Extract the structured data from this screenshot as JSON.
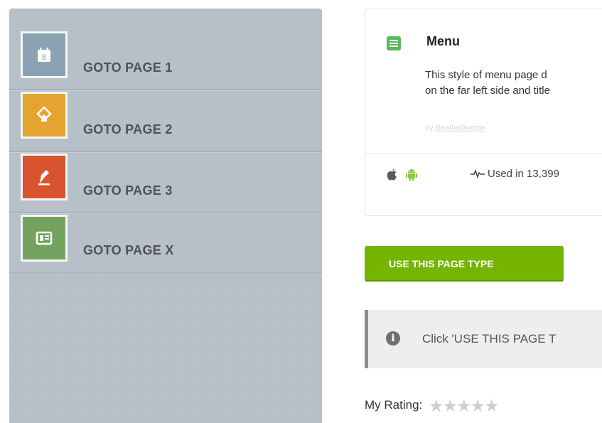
{
  "preview": {
    "menu_items": [
      {
        "label": "GOTO PAGE 1",
        "icon": "calendar-icon",
        "color": "#8aa2b4"
      },
      {
        "label": "GOTO PAGE 2",
        "icon": "thumbs-up-tag-icon",
        "color": "#e5a431"
      },
      {
        "label": "GOTO PAGE 3",
        "icon": "pen-icon",
        "color": "#d8542e"
      },
      {
        "label": "GOTO PAGE X",
        "icon": "contact-card-icon",
        "color": "#74a360"
      }
    ],
    "calendar_number": "8"
  },
  "card": {
    "title": "Menu",
    "description_lines": [
      "This style of menu page d",
      "on the far left side and title"
    ],
    "author_prefix": "by",
    "author_name": "BeatheGoogle",
    "platforms": [
      "apple-icon",
      "android-icon"
    ],
    "usage": "Used in 13,399"
  },
  "cta": {
    "label": "USE THIS PAGE TYPE"
  },
  "notice": {
    "text": "Click 'USE THIS PAGE T"
  },
  "rating": {
    "label": "My Rating:",
    "max_stars": 5,
    "value": 0
  },
  "colors": {
    "accent_green": "#75b500",
    "preview_bg": "#b7c0c8"
  }
}
